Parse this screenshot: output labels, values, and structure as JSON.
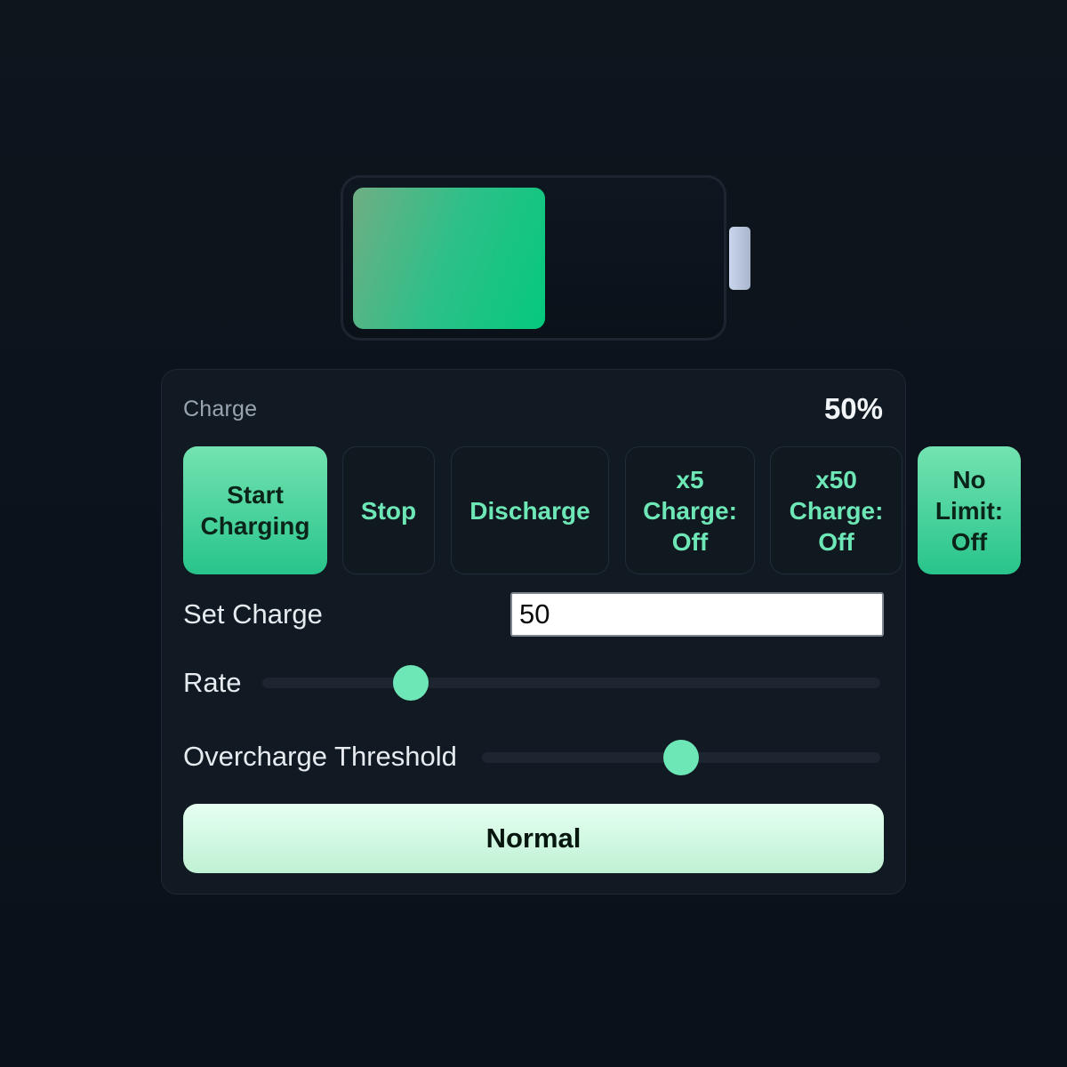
{
  "battery": {
    "level_percent": 50,
    "fill_colors": [
      "#6fae84",
      "#05c97c"
    ],
    "cap_color": "#c9d6ee"
  },
  "status": {
    "label": "Charge",
    "value": "50%"
  },
  "buttons": {
    "start": "Start Charging",
    "stop": "Stop",
    "discharge": "Discharge",
    "x5": "x5 Charge: Off",
    "x50": "x50 Charge: Off",
    "nolimit": "No Limit: Off"
  },
  "set_charge": {
    "label": "Set Charge",
    "value": "50"
  },
  "rate": {
    "label": "Rate",
    "value_fraction": 0.24
  },
  "threshold": {
    "label": "Overcharge Threshold",
    "value_fraction": 0.5
  },
  "mode": {
    "label": "Normal"
  },
  "colors": {
    "accent": "#6ee7b7",
    "accent_dark": "#28c48b",
    "background": "#0d131c",
    "panel": "#111922"
  }
}
